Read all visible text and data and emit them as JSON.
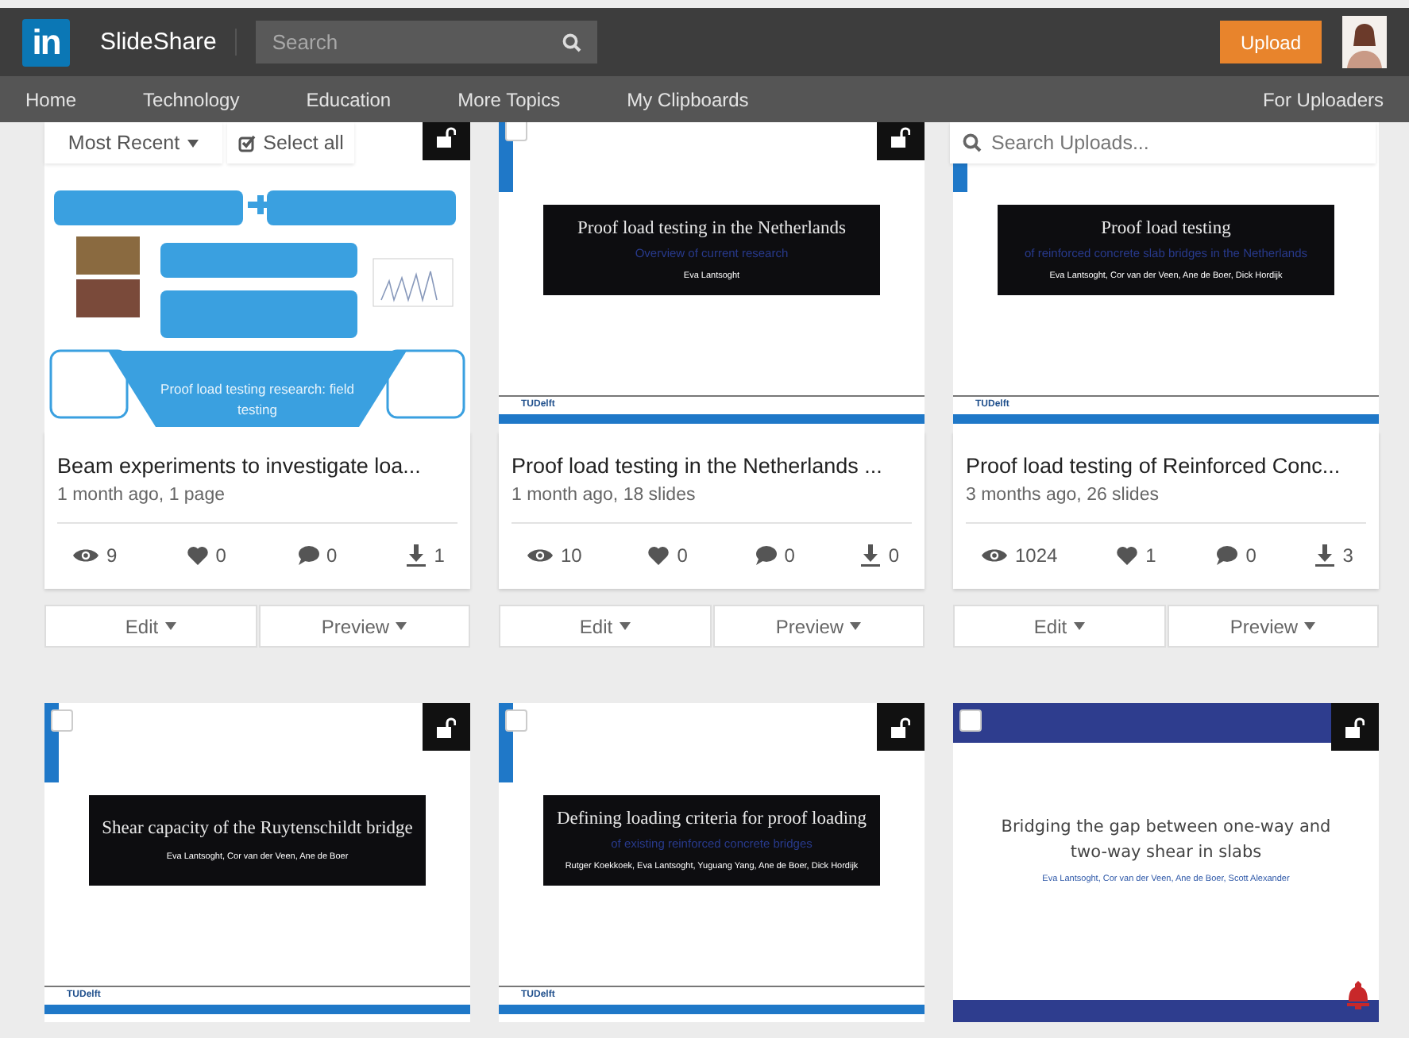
{
  "header": {
    "logo": "in",
    "brand": "SlideShare",
    "search_placeholder": "Search",
    "upload": "Upload"
  },
  "nav": {
    "items": [
      "Home",
      "Technology",
      "Education",
      "More Topics",
      "My Clipboards"
    ],
    "right": "For Uploaders"
  },
  "toolbar": {
    "sort": "Most Recent",
    "select_all": "Select all",
    "search_placeholder": "Search Uploads..."
  },
  "documents": [
    {
      "slide": {
        "kind": "poster",
        "banner": "Proof load testing research: field testing"
      },
      "private": false,
      "title": "Beam experiments to investigate loa...",
      "meta": "1 month ago, 1 page",
      "stats": {
        "views": "9",
        "likes": "0",
        "comments": "0",
        "downloads": "1"
      },
      "edit": "Edit",
      "preview": "Preview"
    },
    {
      "slide": {
        "kind": "tudelft",
        "title": "Proof load testing in the Netherlands",
        "subtitle": "Overview of current research",
        "authors": "Eva Lantsoght",
        "logo": "TUDelft"
      },
      "checked": false,
      "private": false,
      "title": "Proof load testing in the Netherlands ...",
      "meta": "1 month ago, 18 slides",
      "stats": {
        "views": "10",
        "likes": "0",
        "comments": "0",
        "downloads": "0"
      },
      "edit": "Edit",
      "preview": "Preview"
    },
    {
      "slide": {
        "kind": "tudelft",
        "title": "Proof load testing",
        "subtitle": "of reinforced concrete slab bridges in the Netherlands",
        "authors": "Eva Lantsoght, Cor van der Veen, Ane de Boer, Dick Hordijk",
        "logo": "TUDelft"
      },
      "title": "Proof load testing of Reinforced Conc...",
      "meta": "3 months ago, 26 slides",
      "stats": {
        "views": "1024",
        "likes": "1",
        "comments": "0",
        "downloads": "3"
      },
      "edit": "Edit",
      "preview": "Preview"
    },
    {
      "slide": {
        "kind": "tudelft",
        "title": "Shear capacity of the Ruytenschildt bridge",
        "authors": "Eva Lantsoght, Cor van der Veen, Ane de Boer",
        "logo": "TUDelft"
      },
      "checked": false,
      "private": false
    },
    {
      "slide": {
        "kind": "tudelft",
        "title": "Defining loading criteria for proof loading",
        "subtitle": "of existing reinforced concrete bridges",
        "authors": "Rutger Koekkoek, Eva Lantsoght, Yuguang Yang, Ane de Boer, Dick Hordijk",
        "logo": "TUDelft"
      },
      "checked": false,
      "private": false
    },
    {
      "slide": {
        "kind": "banner",
        "title": "Bridging the gap between one-way and two-way shear in slabs",
        "authors": "Eva Lantsoght, Cor van der Veen, Ane de Boer, Scott Alexander"
      },
      "checked": false,
      "private": false
    }
  ]
}
